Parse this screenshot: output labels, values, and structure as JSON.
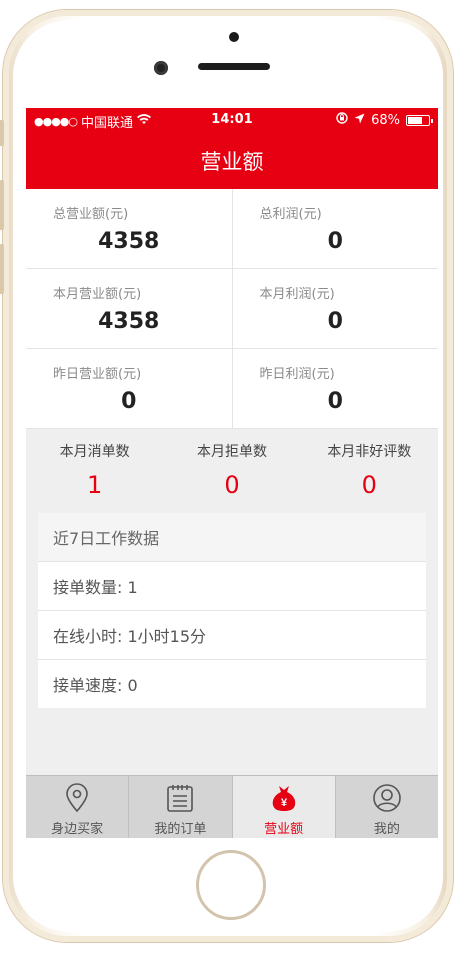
{
  "status": {
    "carrier": "中国联通",
    "time": "14:01",
    "battery_text": "68%",
    "battery_level": 0.68
  },
  "navbar": {
    "title": "营业额"
  },
  "metrics": [
    {
      "label": "总营业额(元)",
      "value": "4358"
    },
    {
      "label": "总利润(元)",
      "value": "0"
    },
    {
      "label": "本月营业额(元)",
      "value": "4358"
    },
    {
      "label": "本月利润(元)",
      "value": "0"
    },
    {
      "label": "昨日营业额(元)",
      "value": "0"
    },
    {
      "label": "昨日利润(元)",
      "value": "0"
    }
  ],
  "counts": [
    {
      "label": "本月消单数",
      "value": "1"
    },
    {
      "label": "本月拒单数",
      "value": "0"
    },
    {
      "label": "本月非好评数",
      "value": "0"
    }
  ],
  "weekly": {
    "title": "近7日工作数据",
    "rows": [
      {
        "text": "接单数量: 1"
      },
      {
        "text": "在线小时: 1小时15分"
      },
      {
        "text": "接单速度: 0"
      }
    ]
  },
  "tabs": [
    {
      "label": "身边买家",
      "icon": "location-pin-icon"
    },
    {
      "label": "我的订单",
      "icon": "order-list-icon"
    },
    {
      "label": "营业额",
      "icon": "money-bag-icon",
      "active": true
    },
    {
      "label": "我的",
      "icon": "user-icon"
    }
  ],
  "colors": {
    "accent": "#e60012",
    "background": "#efefef",
    "tabbar": "#d4d4d4"
  }
}
